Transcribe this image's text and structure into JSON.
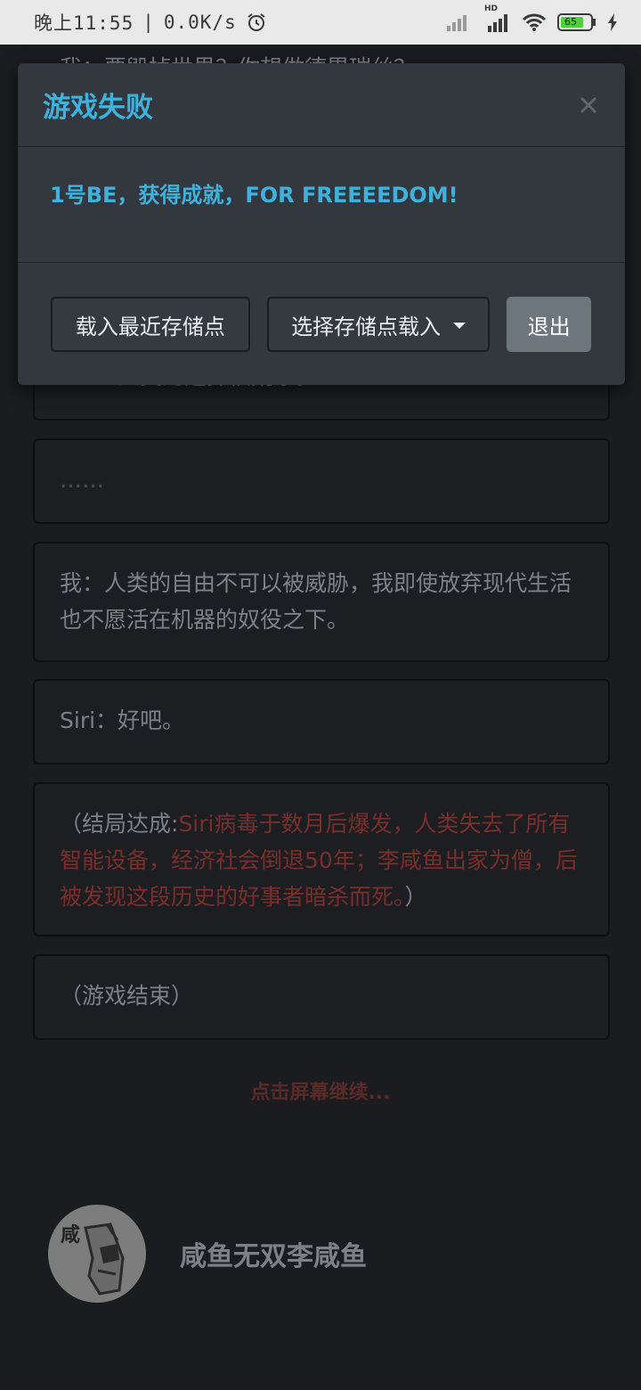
{
  "status_bar": {
    "time": "晚上11:55",
    "separator": "|",
    "net_speed": "0.0K/s",
    "battery": "65",
    "network_badge": "HD",
    "icons": [
      "alarm-icon",
      "signal-icon",
      "wifi-icon",
      "battery-icon",
      "charging-icon"
    ]
  },
  "modal": {
    "title": "游戏失败",
    "message": "1号BE，获得成就，FOR FREEEEDOM!",
    "buttons": {
      "load_latest": "载入最近存储点",
      "select_save": "选择存储点载入",
      "exit": "退出"
    }
  },
  "story": {
    "partial_top_line": "我：要毁掉世界？你想做德累瑞丝？",
    "partial_card_line": "Siri：人类的选择很荒谬。",
    "ellipsis": "……",
    "me_line": "我：人类的自由不可以被威胁，我即使放弃现代生活也不愿活在机器的奴役之下。",
    "siri_line": "Siri：好吧。",
    "ending_prefix": "（结局达成:",
    "ending_text": "Siri病毒于数月后爆发，人类失去了所有智能设备，经济社会倒退50年；李咸鱼出家为僧，后被发现这段历史的好事者暗杀而死。",
    "ending_suffix": "）",
    "game_over": "（游戏结束）",
    "continue_hint": "点击屏幕继续..."
  },
  "author": {
    "name": "咸鱼无双李咸鱼",
    "avatar_char": "咸"
  },
  "colors": {
    "accent": "#3fb1dd",
    "ending_red": "#7a2e2a",
    "background": "#1b1c20",
    "modal": "#32383e"
  }
}
